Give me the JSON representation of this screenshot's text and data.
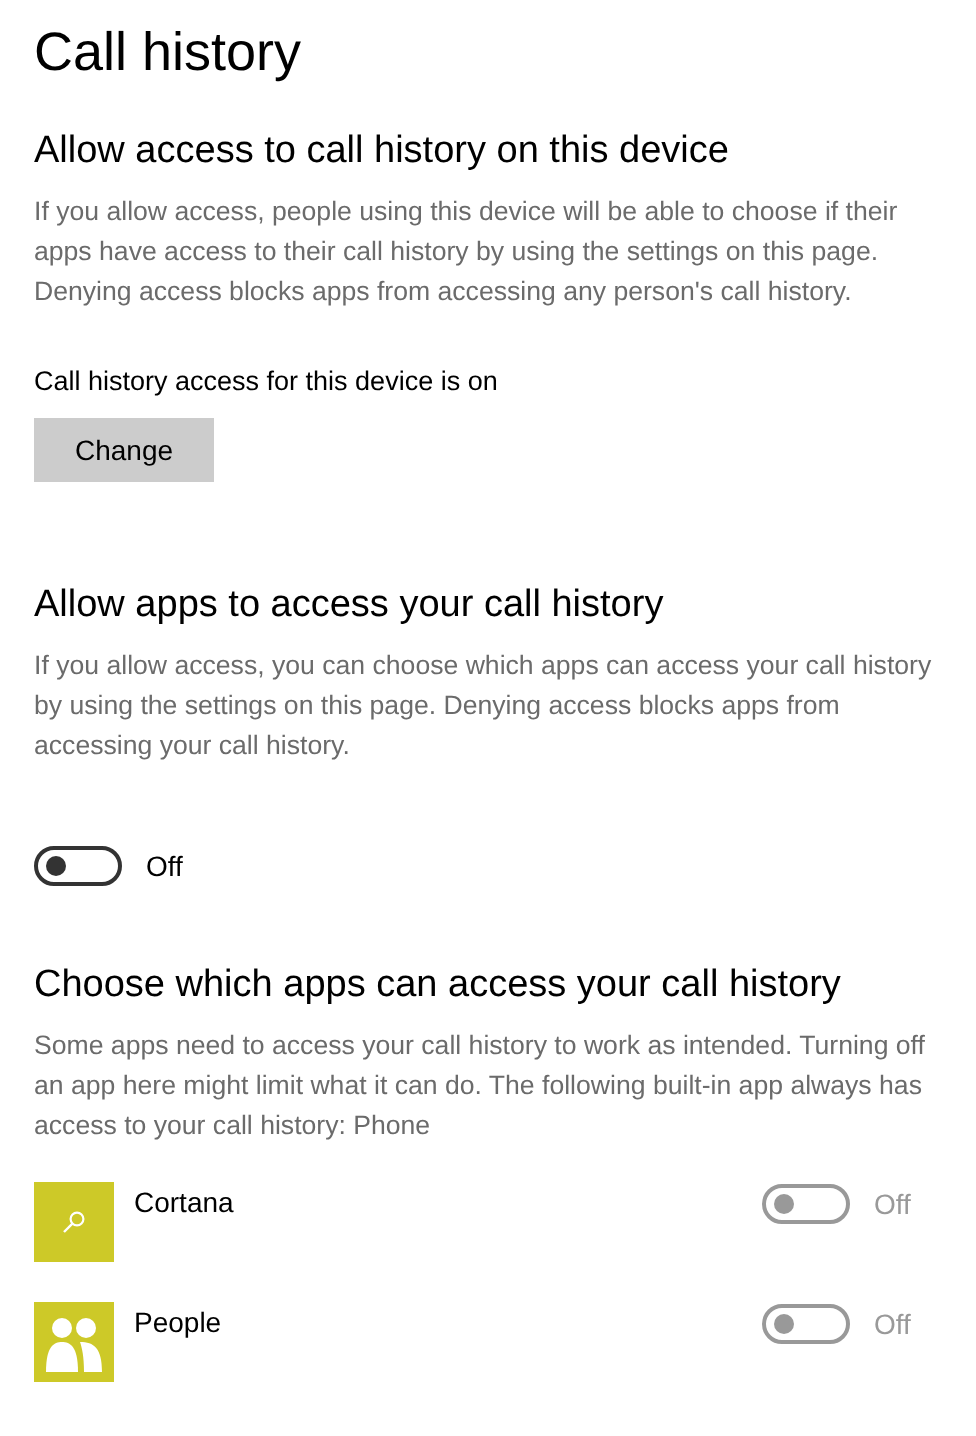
{
  "title": "Call history",
  "device_section": {
    "heading": "Allow access to call history on this device",
    "description": "If you allow access, people using this device will be able to choose if their apps have access to their call history by using the settings on this page. Denying access blocks apps from accessing any person's call history.",
    "status": "Call history access for this device is on",
    "button": "Change"
  },
  "apps_section": {
    "heading": "Allow apps to access your call history",
    "description": "If you allow access, you can choose which apps can access your call history by using the settings on this page. Denying access blocks apps from accessing your call history.",
    "toggle": {
      "on": false,
      "label": "Off"
    }
  },
  "choose_section": {
    "heading": "Choose which apps can access your call history",
    "description": "Some apps need to access your call history to work as intended. Turning off an app here might limit what it can do. The following built-in app always has access to your call history: Phone",
    "apps": [
      {
        "name": "Cortana",
        "kind": "search",
        "on": false,
        "disabled": true,
        "label": "Off"
      },
      {
        "name": "People",
        "kind": "people",
        "on": false,
        "disabled": true,
        "label": "Off"
      }
    ]
  }
}
